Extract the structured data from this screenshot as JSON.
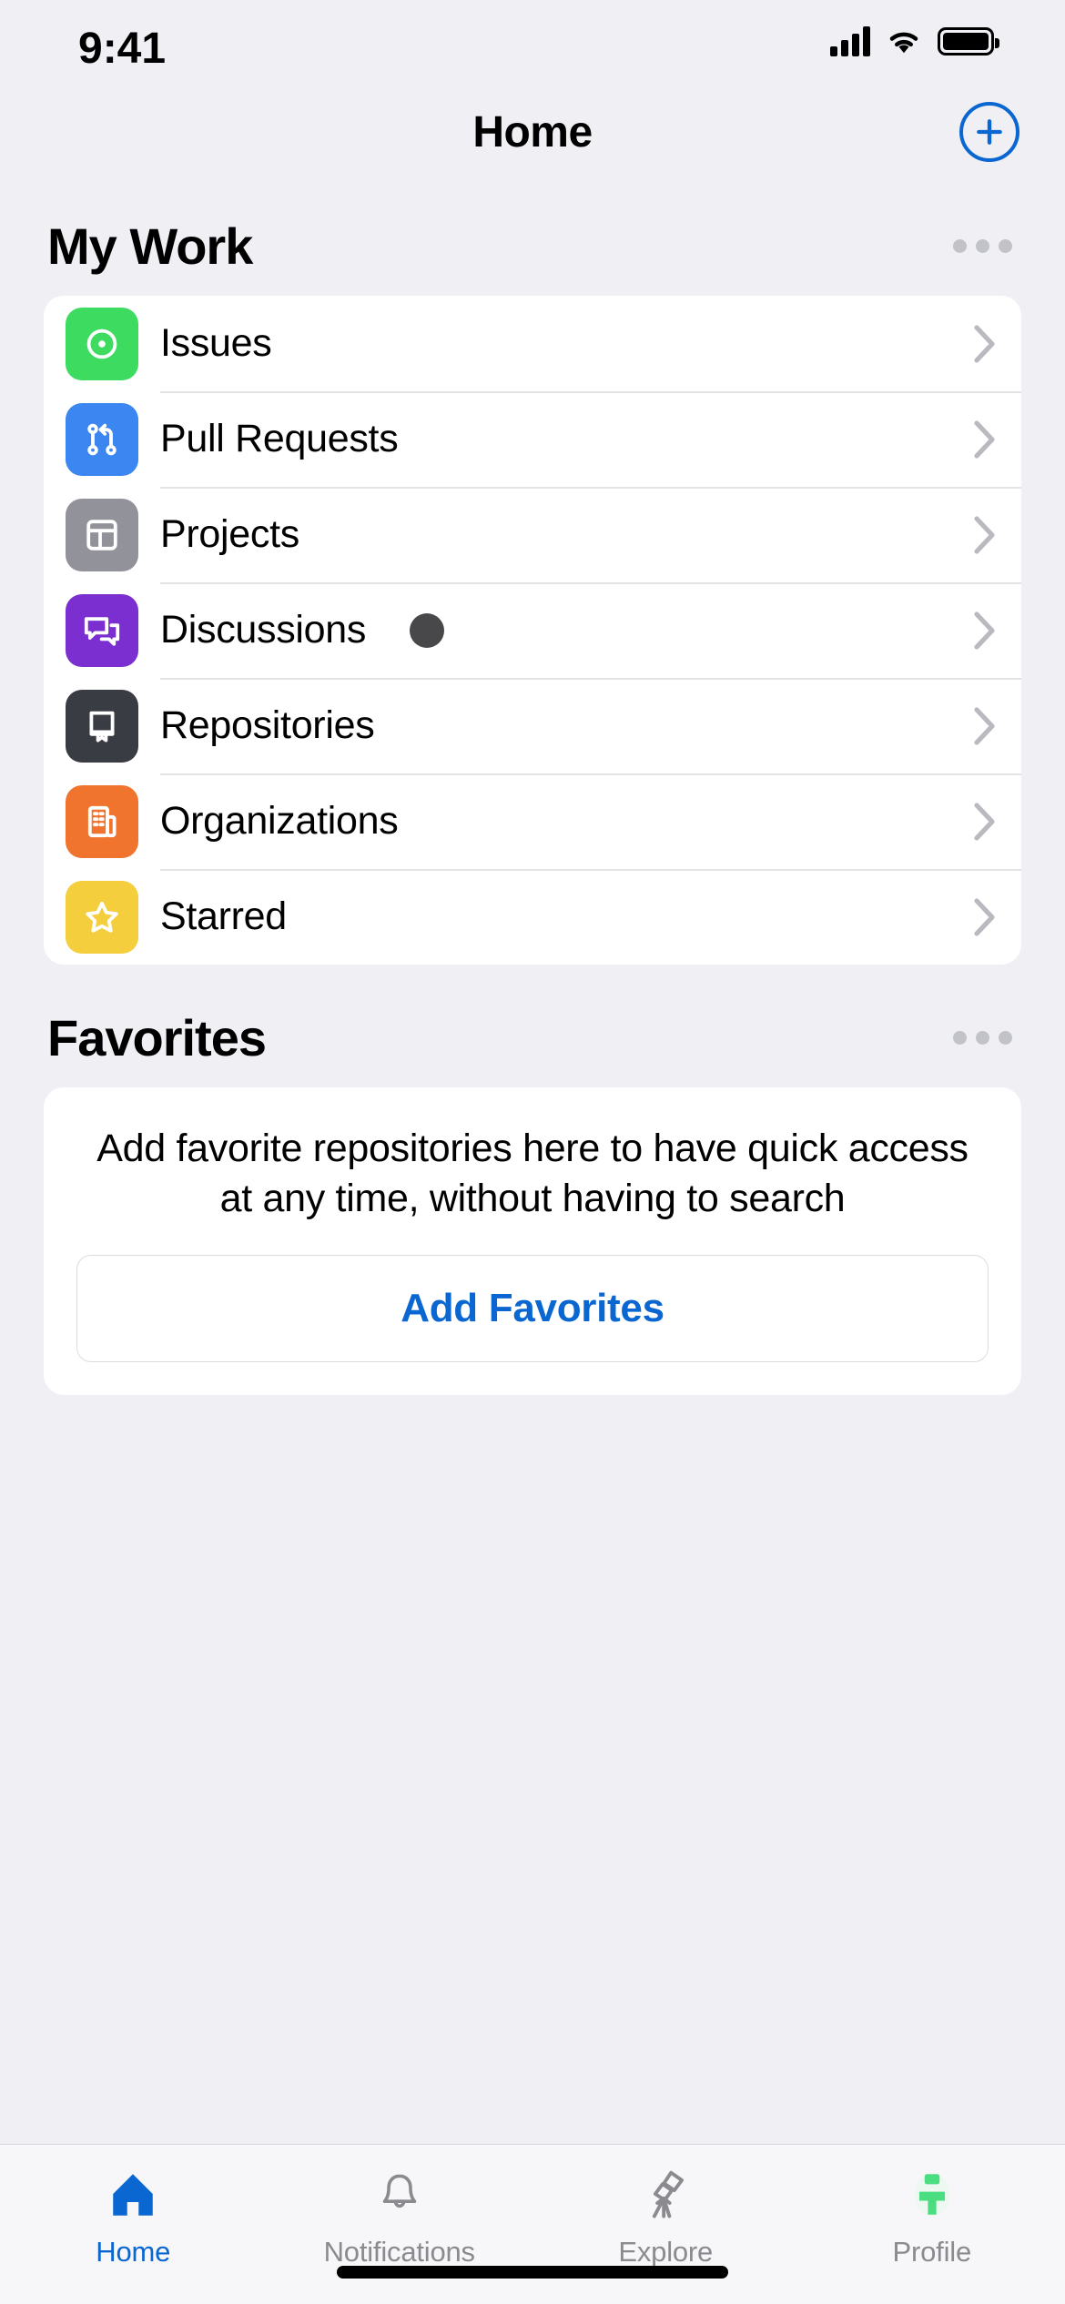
{
  "status_bar": {
    "time": "9:41",
    "signal_icon": "cellular-bars-icon",
    "wifi_icon": "wifi-icon",
    "battery_icon": "battery-full-icon"
  },
  "nav_bar": {
    "title": "Home",
    "add_button_icon": "plus-circle-icon",
    "accent_color": "#0A66D0"
  },
  "my_work": {
    "title": "My Work",
    "more_icon": "ellipsis-icon",
    "items": [
      {
        "label": "Issues",
        "icon": "issue-opened-icon",
        "color": "#3DDC60",
        "badge": false,
        "chevron_icon": "chevron-right-icon"
      },
      {
        "label": "Pull Requests",
        "icon": "git-pull-request-icon",
        "color": "#3B86F0",
        "badge": false,
        "chevron_icon": "chevron-right-icon"
      },
      {
        "label": "Projects",
        "icon": "project-board-icon",
        "color": "#92929B",
        "badge": false,
        "chevron_icon": "chevron-right-icon"
      },
      {
        "label": "Discussions",
        "icon": "comment-discussion-icon",
        "color": "#7B2FD0",
        "badge": true,
        "chevron_icon": "chevron-right-icon"
      },
      {
        "label": "Repositories",
        "icon": "repo-icon",
        "color": "#3A3C44",
        "badge": false,
        "chevron_icon": "chevron-right-icon"
      },
      {
        "label": "Organizations",
        "icon": "organization-icon",
        "color": "#F0732E",
        "badge": false,
        "chevron_icon": "chevron-right-icon"
      },
      {
        "label": "Starred",
        "icon": "star-icon",
        "color": "#F5CE3E",
        "badge": false,
        "chevron_icon": "chevron-right-icon"
      }
    ]
  },
  "favorites": {
    "title": "Favorites",
    "more_icon": "ellipsis-icon",
    "empty_text": "Add favorite repositories here to have quick access at any time, without having to search",
    "add_button_label": "Add Favorites"
  },
  "tab_bar": {
    "items": [
      {
        "label": "Home",
        "icon": "home-icon",
        "active": true
      },
      {
        "label": "Notifications",
        "icon": "bell-icon",
        "active": false
      },
      {
        "label": "Explore",
        "icon": "telescope-icon",
        "active": false
      },
      {
        "label": "Profile",
        "icon": "avatar-icon",
        "active": false
      }
    ],
    "active_color": "#0A66D0",
    "inactive_color": "#8A8A8F"
  }
}
